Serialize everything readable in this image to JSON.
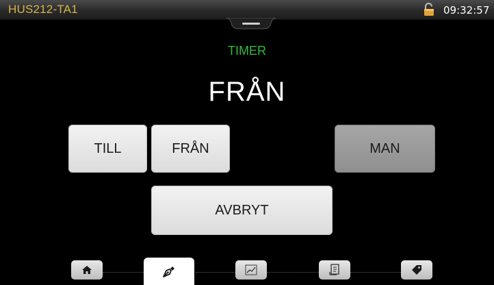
{
  "status_bar": {
    "device_name": "HUS212-TA1",
    "time": "09:32:57",
    "lock_icon": "unlocked-padlock-icon"
  },
  "screen": {
    "subtitle": "TIMER",
    "title": "FRÅN"
  },
  "buttons": {
    "till": "TILL",
    "fran": "FRÅN",
    "man": "MAN",
    "avbryt": "AVBRYT"
  },
  "nav": {
    "items": [
      {
        "icon": "home-icon",
        "active": false
      },
      {
        "icon": "pen-icon",
        "active": true
      },
      {
        "icon": "chart-icon",
        "active": false
      },
      {
        "icon": "document-icon",
        "active": false
      },
      {
        "icon": "tag-icon",
        "active": false
      }
    ]
  },
  "colors": {
    "device_name": "#d7b64a",
    "subtitle": "#2fbd3a",
    "background": "#000000"
  }
}
